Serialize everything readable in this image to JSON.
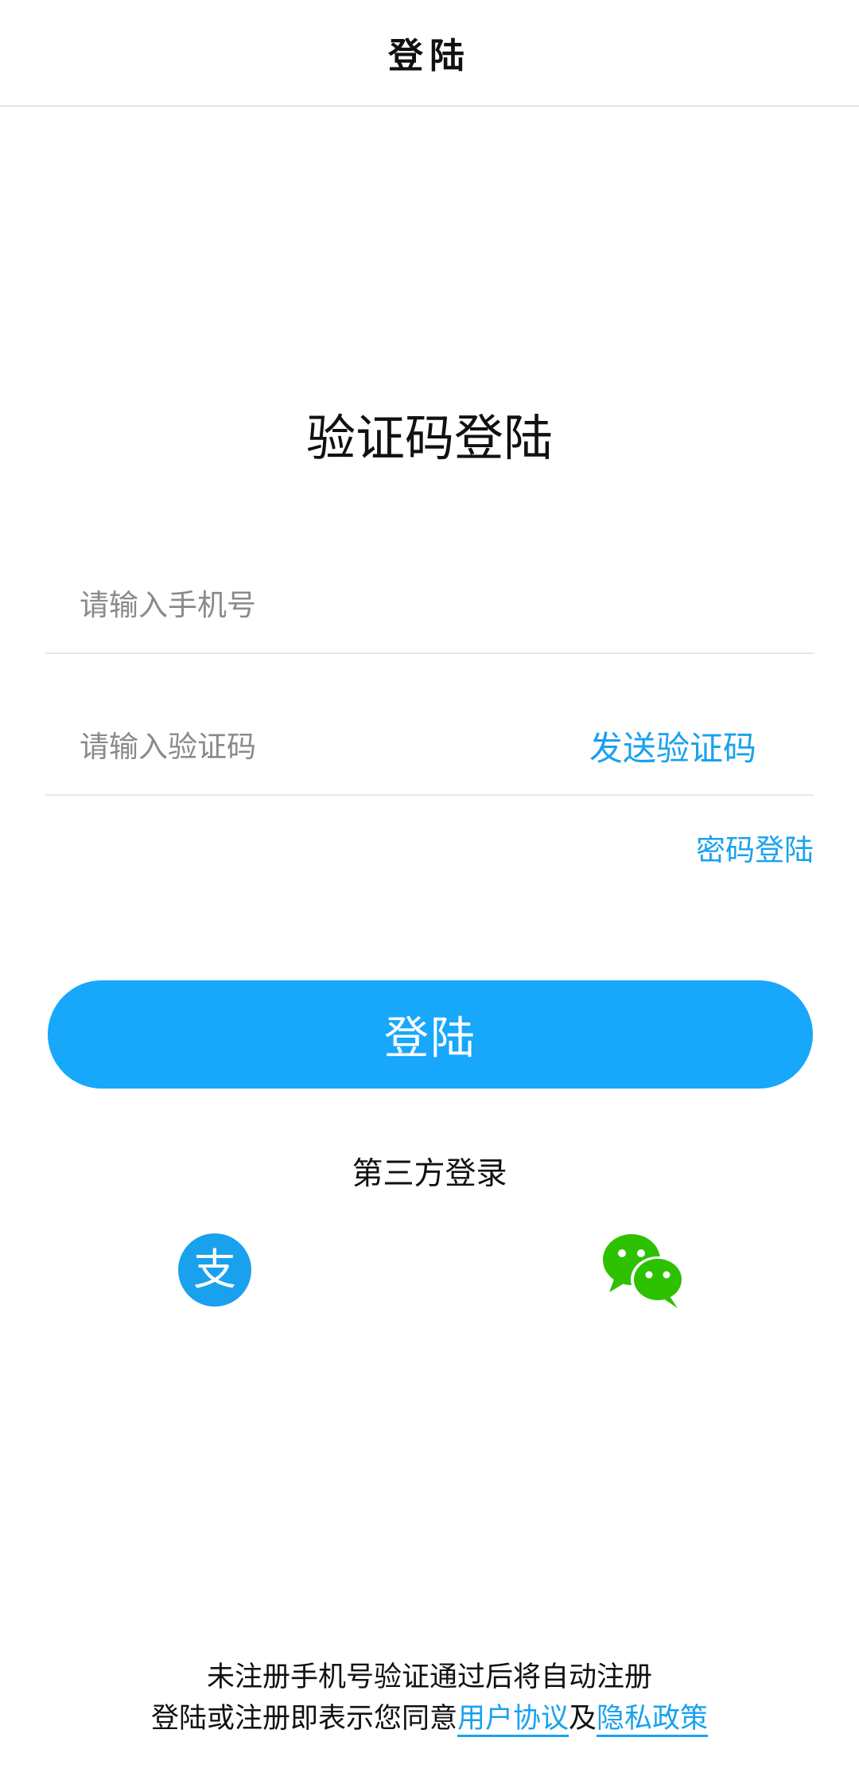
{
  "nav": {
    "title": "登陆"
  },
  "login": {
    "heading": "验证码登陆",
    "phone_placeholder": "请输入手机号",
    "code_placeholder": "请输入验证码",
    "send_code_label": "发送验证码",
    "password_login_label": "密码登陆",
    "submit_label": "登陆"
  },
  "third_party": {
    "label": "第三方登录",
    "providers": [
      {
        "icon": "alipay-icon",
        "color": "#1aa1ee",
        "glyph": "支"
      },
      {
        "icon": "wechat-icon",
        "color": "#2dc100"
      }
    ]
  },
  "footer": {
    "line1": "未注册手机号验证通过后将自动注册",
    "line2_prefix": "登陆或注册即表示您同意",
    "user_agreement": "用户协议",
    "conjunction": "及",
    "privacy_policy": "隐私政策"
  },
  "colors": {
    "accent": "#1aa1ee",
    "button_bg": "#17a7fb",
    "wechat": "#2dc100"
  }
}
